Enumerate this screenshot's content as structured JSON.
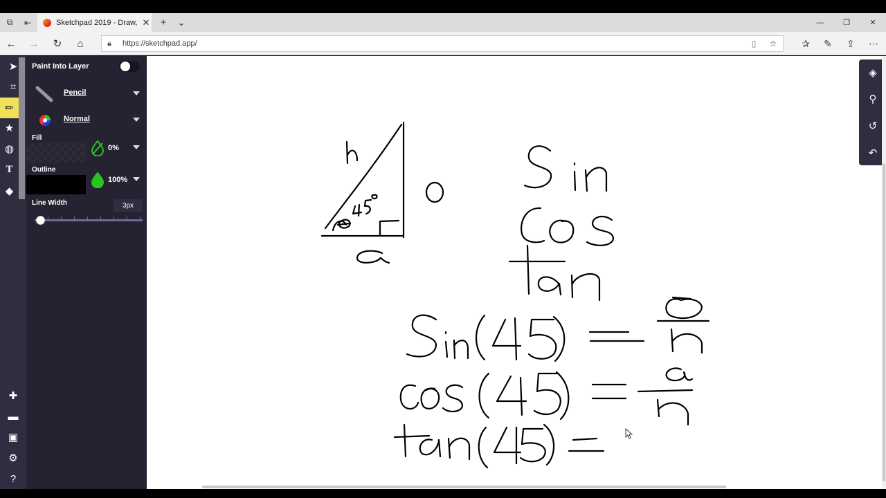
{
  "browser": {
    "tab_title": "Sketchpad 2019 - Draw,",
    "tab_close": "✕",
    "new_tab": "+",
    "tab_list": "⌄",
    "url": "https://sketchpad.app/",
    "window_controls": {
      "minimize": "—",
      "restore": "❐",
      "close": "✕"
    }
  },
  "panel": {
    "paint_into_layer": "Paint Into Layer",
    "brush": "Pencil",
    "blend_mode": "Normal",
    "fill_label": "Fill",
    "fill_opacity": "0%",
    "outline_label": "Outline",
    "outline_opacity": "100%",
    "line_width_label": "Line Width",
    "line_width_value": "3px",
    "line_width_level": 0.05
  },
  "colors": {
    "app_dark": "#2f2d40",
    "panel_bg": "#252332",
    "active_tool": "#f0e05a",
    "fill_green": "#27c41f"
  },
  "left_tools": [
    "select-icon",
    "crop-icon",
    "pencil-icon",
    "star-icon",
    "globe-icon",
    "text-icon",
    "fill-bucket-icon"
  ],
  "left_bottom_tools": [
    "plus-icon",
    "folder-icon",
    "save-icon",
    "settings-icon",
    "help-icon"
  ],
  "right_tools": [
    "layers-icon",
    "search-icon",
    "history-icon",
    "undo-icon"
  ]
}
